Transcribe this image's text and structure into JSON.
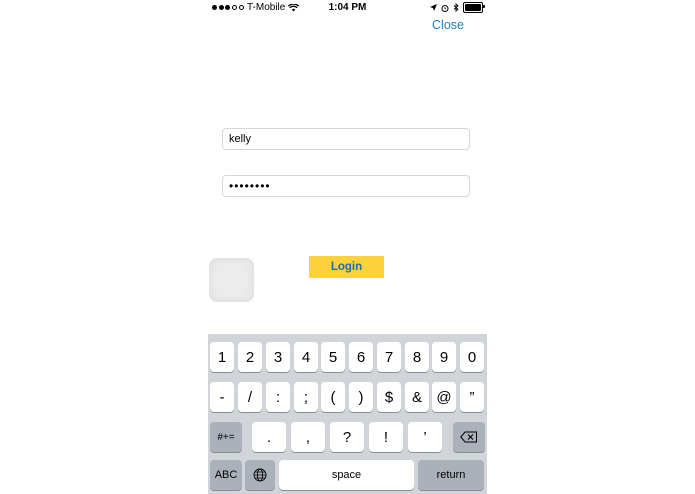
{
  "status_bar": {
    "signal_dots": 5,
    "signal_filled": 3,
    "carrier": "T-Mobile",
    "time": "1:04 PM",
    "battery_level": 1.0
  },
  "nav": {
    "close_label": "Close"
  },
  "form": {
    "username_value": "kelly",
    "password_value": "••••••••",
    "login_label": "Login"
  },
  "colors": {
    "accent": "#1a7fc4",
    "login_bg": "#fbd23a",
    "keyboard_bg": "#d1d4d9",
    "dark_key": "#abb1ba"
  },
  "keyboard": {
    "row1": [
      "1",
      "2",
      "3",
      "4",
      "5",
      "6",
      "7",
      "8",
      "9",
      "0"
    ],
    "row2": [
      "-",
      "/",
      ":",
      ";",
      "(",
      ")",
      "$",
      "&",
      "@",
      "”"
    ],
    "row3": {
      "left": "#+=",
      "keys": [
        ".",
        ",",
        "?",
        "!",
        "’"
      ]
    },
    "row4": {
      "abc": "ABC",
      "space": "space",
      "return": "return"
    },
    "icons": [
      "globe-icon",
      "delete-icon"
    ]
  }
}
